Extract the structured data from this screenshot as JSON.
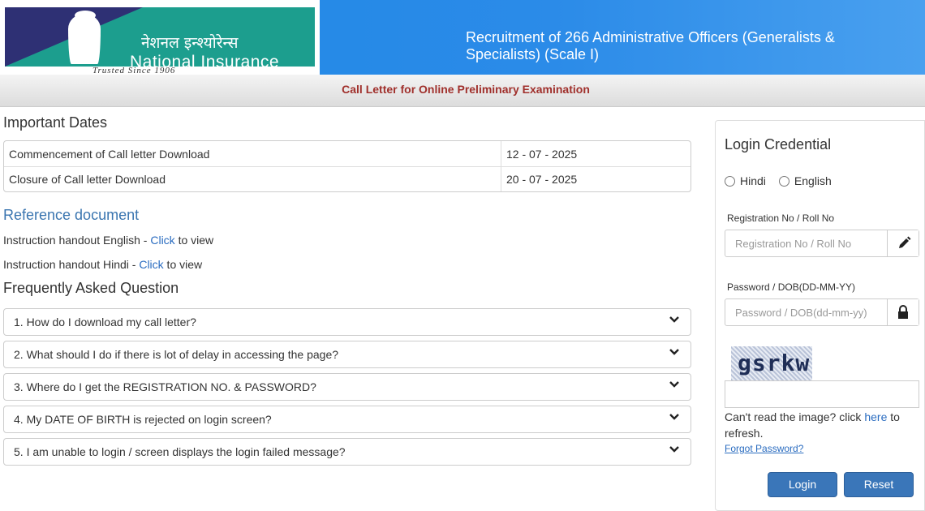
{
  "header": {
    "logo_hindi": "नेशनल इन्श्योरेन्स",
    "logo_english": "National Insurance",
    "logo_tagline": "Trusted Since 1906",
    "title": "Recruitment of 266 Administrative Officers (Generalists & Specialists) (Scale I)"
  },
  "subbar": {
    "title": "Call Letter for Online Preliminary Examination"
  },
  "important_dates": {
    "heading": "Important Dates",
    "rows": [
      {
        "label": "Commencement of Call letter Download",
        "date": "12 - 07 - 2025"
      },
      {
        "label": "Closure of Call letter Download",
        "date": "20 - 07 - 2025"
      }
    ]
  },
  "reference": {
    "heading": "Reference document",
    "items": [
      {
        "prefix": "Instruction handout English - ",
        "link": "Click",
        "suffix": " to view"
      },
      {
        "prefix": "Instruction handout Hindi - ",
        "link": "Click",
        "suffix": " to view"
      }
    ]
  },
  "faq": {
    "heading": "Frequently Asked Question",
    "items": [
      "1. How do I download my call letter?",
      "2. What should I do if there is lot of delay in accessing the page?",
      "3. Where do I get the REGISTRATION NO. & PASSWORD?",
      "4. My DATE OF BIRTH is rejected on login screen?",
      "5. I am unable to login / screen displays the login failed message?"
    ]
  },
  "login": {
    "title": "Login Credential",
    "lang_options": [
      "Hindi",
      "English"
    ],
    "reg_label": "Registration No / Roll No",
    "reg_placeholder": "Registration No / Roll No",
    "pwd_label": "Password / DOB(DD-MM-YY)",
    "pwd_placeholder": "Password / DOB(dd-mm-yy)",
    "captcha_text": "gsrkw",
    "captcha_value": "",
    "refresh_prefix": "Can't read the image? click ",
    "refresh_link": "here",
    "refresh_suffix": " to refresh.",
    "forgot": "Forgot Password?",
    "login_btn": "Login",
    "reset_btn": "Reset",
    "icons": {
      "reg": "pencil-icon",
      "pwd": "lock-icon"
    }
  }
}
